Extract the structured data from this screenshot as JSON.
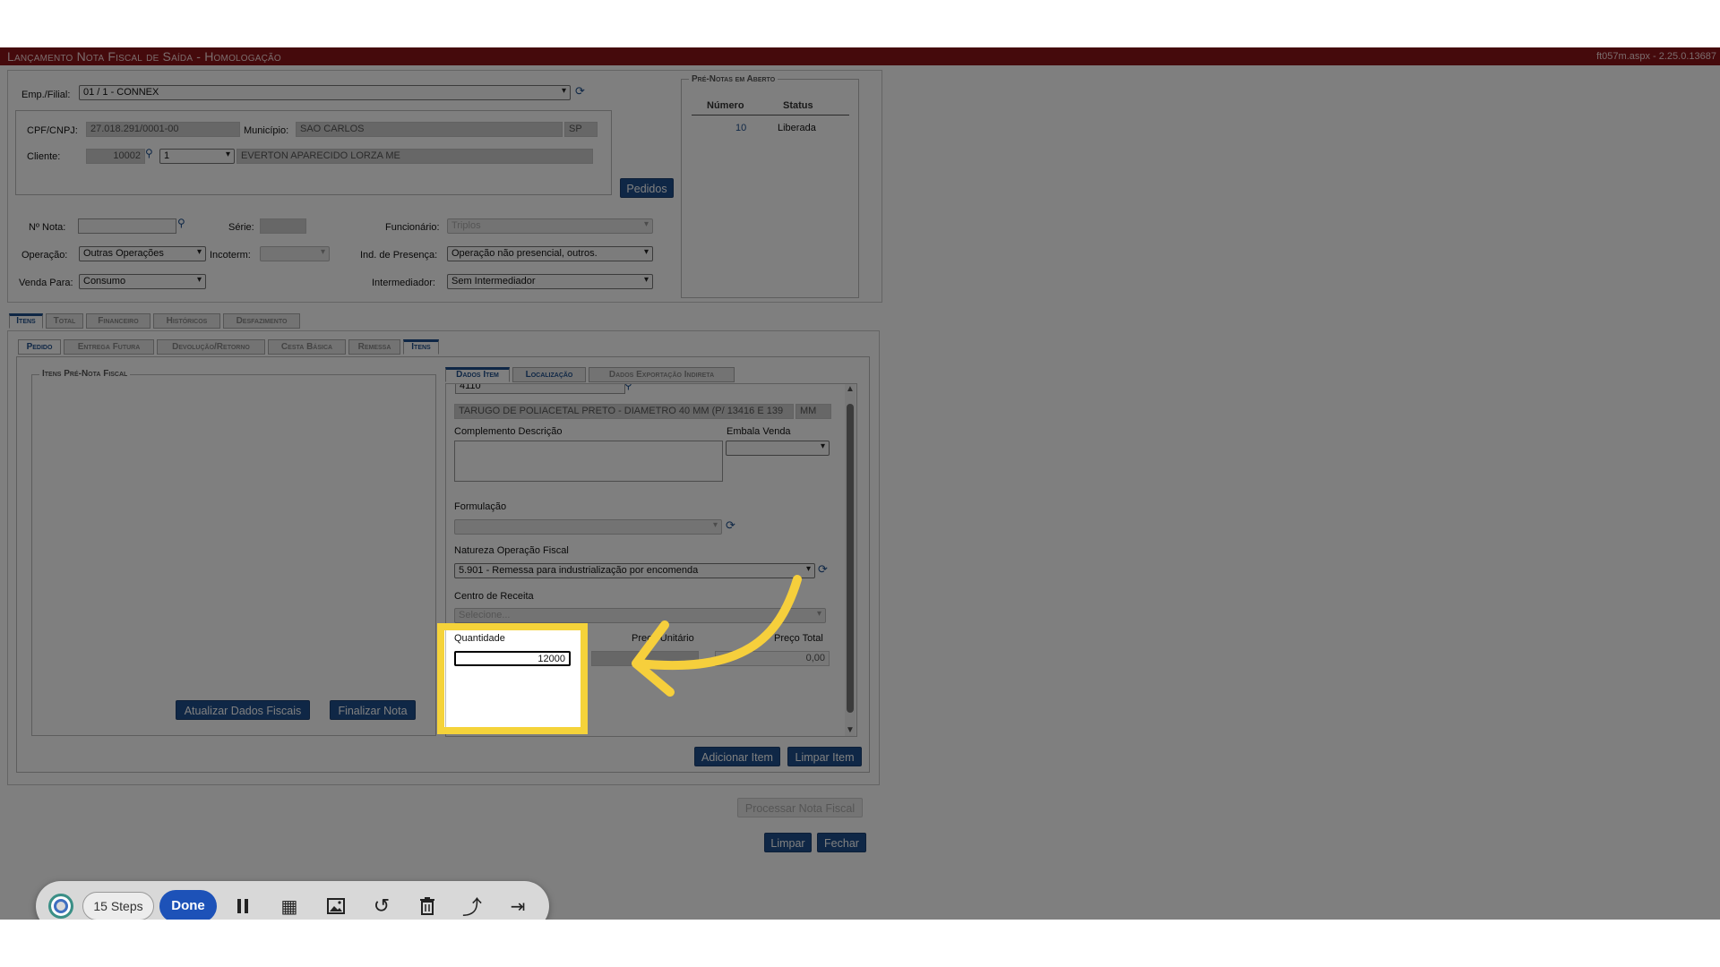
{
  "header": {
    "title": "Lançamento Nota Fiscal de Saída - Homologação",
    "version": "ft057m.aspx - 2.25.0.13687"
  },
  "form": {
    "emp_label": "Emp./Filial:",
    "emp_value": "01 / 1 - CONNEX",
    "cpf_label": "CPF/CNPJ:",
    "cpf_value": "27.018.291/0001-00",
    "mun_label": "Município:",
    "mun_value": "SAO CARLOS",
    "uf_value": "SP",
    "cliente_label": "Cliente:",
    "cliente_code": "10002",
    "cliente_seq": "1",
    "cliente_name": "EVERTON APARECIDO LORZA ME",
    "pedidos_btn": "Pedidos",
    "nota_label": "Nº Nota:",
    "serie_label": "Série:",
    "func_label": "Funcionário:",
    "func_value": "Triplos",
    "operacao_label": "Operação:",
    "operacao_value": "Outras Operações",
    "incoterm_label": "Incoterm:",
    "ind_presenca_label": "Ind. de Presença:",
    "ind_presenca_value": "Operação não presencial, outros.",
    "venda_para_label": "Venda Para:",
    "venda_para_value": "Consumo",
    "intermediador_label": "Intermediador:",
    "intermediador_value": "Sem Intermediador"
  },
  "prenotas": {
    "legend": "Pré-Notas em Aberto",
    "col_numero": "Número",
    "col_status": "Status",
    "rows": [
      {
        "numero": "10",
        "status": "Liberada"
      }
    ]
  },
  "tabs_main": [
    "Itens",
    "Total",
    "Financeiro",
    "Históricos",
    "Desfazimento"
  ],
  "tabs_sub": [
    "Pedido",
    "Entrega Futura",
    "Devolução/Retorno",
    "Cesta Básica",
    "Remessa",
    "Itens"
  ],
  "itens_panel": {
    "legend": "Itens Pré-Nota Fiscal",
    "btn_atualizar": "Atualizar Dados Fiscais",
    "btn_finalizar": "Finalizar Nota"
  },
  "item_tabs": [
    "Dados Item",
    "Localização",
    "Dados Exportação Indireta"
  ],
  "item": {
    "code_partial": "4110",
    "descricao": "TARUGO DE POLIACETAL PRETO - DIAMETRO 40 MM (P/ 13416 E 139",
    "unidade": "MM",
    "complemento_label": "Complemento Descrição",
    "embala_label": "Embala Venda",
    "formulacao_label": "Formulação",
    "natureza_label": "Natureza Operação Fiscal",
    "natureza_value": "5.901 - Remessa para industrialização por encomenda",
    "centro_label": "Centro de Receita",
    "centro_value": "Selecione...",
    "quantidade_label": "Quantidade",
    "quantidade_value": "12000",
    "preco_unit_label": "Preço Unitário",
    "preco_total_label": "Preço Total",
    "preco_total_value": "0,00",
    "btn_adicionar": "Adicionar Item",
    "btn_limpar_item": "Limpar Item"
  },
  "actions": {
    "processar": "Processar Nota Fiscal",
    "limpar": "Limpar",
    "fechar": "Fechar"
  },
  "recorder": {
    "steps": "15 Steps",
    "done": "Done"
  },
  "colors": {
    "title_bar": "#8b1418",
    "button_blue": "#1e4f8c",
    "highlight": "#f5d33a",
    "arrow": "#f6cf3c"
  }
}
